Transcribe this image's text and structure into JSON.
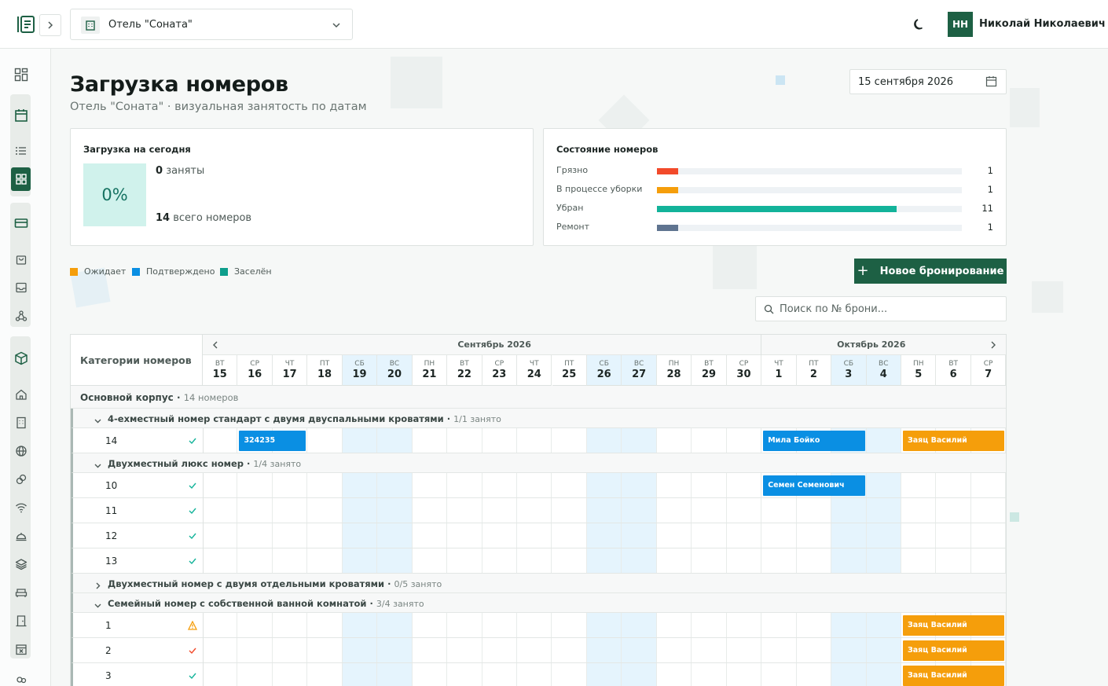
{
  "topbar": {
    "hotel_name": "Отель \"Соната\"",
    "user_initials": "НН",
    "user_name": "Николай Николаевич"
  },
  "page": {
    "title": "Загрузка номеров",
    "subtitle": "Отель \"Соната\" · визуальная занятость по датам",
    "date": "15 сентября 2026"
  },
  "occupancy": {
    "title": "Загрузка на сегодня",
    "percent": "0%",
    "occupied_count": "0",
    "occupied_label": "заняты",
    "total_count": "14",
    "total_label": "всего номеров"
  },
  "room_status": {
    "title": "Состояние номеров",
    "items": [
      {
        "label": "Грязно",
        "count": "1",
        "fraction": 0.07,
        "color": "#f24a2a"
      },
      {
        "label": "В процессе уборки",
        "count": "1",
        "fraction": 0.07,
        "color": "#f59e0b"
      },
      {
        "label": "Убран",
        "count": "11",
        "fraction": 0.786,
        "color": "#13b39a"
      },
      {
        "label": "Ремонт",
        "count": "1",
        "fraction": 0.07,
        "color": "#5f7490"
      }
    ]
  },
  "legend": [
    {
      "label": "Ожидает",
      "color": "#f59e0b"
    },
    {
      "label": "Подтверждено",
      "color": "#0a8fe3"
    },
    {
      "label": "Заселён",
      "color": "#0e9e8c"
    }
  ],
  "actions": {
    "new_booking": "Новое бронирование",
    "search_placeholder": "Поиск по № брони..."
  },
  "calendar": {
    "header_left": "Категории номеров",
    "months": [
      {
        "label": "Сентябрь 2026",
        "start": 0,
        "span": 16
      },
      {
        "label": "Октябрь 2026",
        "start": 16,
        "span": 7
      }
    ],
    "days": [
      {
        "dow": "ВТ",
        "num": "15",
        "weekend": false
      },
      {
        "dow": "СР",
        "num": "16",
        "weekend": false
      },
      {
        "dow": "ЧТ",
        "num": "17",
        "weekend": false
      },
      {
        "dow": "ПТ",
        "num": "18",
        "weekend": false
      },
      {
        "dow": "СБ",
        "num": "19",
        "weekend": true
      },
      {
        "dow": "ВС",
        "num": "20",
        "weekend": true
      },
      {
        "dow": "ПН",
        "num": "21",
        "weekend": false
      },
      {
        "dow": "ВТ",
        "num": "22",
        "weekend": false
      },
      {
        "dow": "СР",
        "num": "23",
        "weekend": false
      },
      {
        "dow": "ЧТ",
        "num": "24",
        "weekend": false
      },
      {
        "dow": "ПТ",
        "num": "25",
        "weekend": false
      },
      {
        "dow": "СБ",
        "num": "26",
        "weekend": true
      },
      {
        "dow": "ВС",
        "num": "27",
        "weekend": true
      },
      {
        "dow": "ПН",
        "num": "28",
        "weekend": false
      },
      {
        "dow": "ВТ",
        "num": "29",
        "weekend": false
      },
      {
        "dow": "СР",
        "num": "30",
        "weekend": false
      },
      {
        "dow": "ЧТ",
        "num": "1",
        "weekend": false
      },
      {
        "dow": "ПТ",
        "num": "2",
        "weekend": false
      },
      {
        "dow": "СБ",
        "num": "3",
        "weekend": true
      },
      {
        "dow": "ВС",
        "num": "4",
        "weekend": true
      },
      {
        "dow": "ПН",
        "num": "5",
        "weekend": false
      },
      {
        "dow": "ВТ",
        "num": "6",
        "weekend": false
      },
      {
        "dow": "СР",
        "num": "7",
        "weekend": false
      }
    ],
    "building": {
      "name": "Основной корпус",
      "count": "14 номеров"
    },
    "rows": [
      {
        "type": "category",
        "name": "4-ехместный номер стандарт с двумя двуспальными кроватями",
        "occ": "1/1 занято",
        "expanded": true
      },
      {
        "type": "room",
        "number": "14",
        "status": "clean",
        "bookings": [
          {
            "label": "324235",
            "start": 1,
            "span": 2,
            "color": "#0a8fe3"
          },
          {
            "label": "Мила Бойко",
            "start": 16,
            "span": 3,
            "color": "#0a8fe3"
          },
          {
            "label": "Заяц Василий",
            "start": 20,
            "span": 3,
            "color": "#f59e0b"
          }
        ]
      },
      {
        "type": "category",
        "name": "Двухместный люкс номер",
        "occ": "1/4 занято",
        "expanded": true
      },
      {
        "type": "room",
        "number": "10",
        "status": "clean",
        "bookings": [
          {
            "label": "Семен Семенович",
            "start": 16,
            "span": 3,
            "color": "#0a8fe3"
          }
        ]
      },
      {
        "type": "room",
        "number": "11",
        "status": "clean",
        "bookings": []
      },
      {
        "type": "room",
        "number": "12",
        "status": "clean",
        "bookings": []
      },
      {
        "type": "room",
        "number": "13",
        "status": "clean",
        "bookings": []
      },
      {
        "type": "category",
        "name": "Двухместный номер с двумя отдельными кроватями",
        "occ": "0/5 занято",
        "expanded": false
      },
      {
        "type": "category",
        "name": "Семейный номер с собственной ванной комнатой",
        "occ": "3/4 занято",
        "expanded": true
      },
      {
        "type": "room",
        "number": "1",
        "status": "dirty",
        "bookings": [
          {
            "label": "Заяц Василий",
            "start": 20,
            "span": 3,
            "color": "#f59e0b"
          }
        ]
      },
      {
        "type": "room",
        "number": "2",
        "status": "cleaning",
        "bookings": [
          {
            "label": "Заяц Василий",
            "start": 20,
            "span": 3,
            "color": "#f59e0b"
          }
        ]
      },
      {
        "type": "room",
        "number": "3",
        "status": "clean",
        "bookings": [
          {
            "label": "Заяц Василий",
            "start": 20,
            "span": 3,
            "color": "#f59e0b"
          }
        ]
      }
    ]
  }
}
